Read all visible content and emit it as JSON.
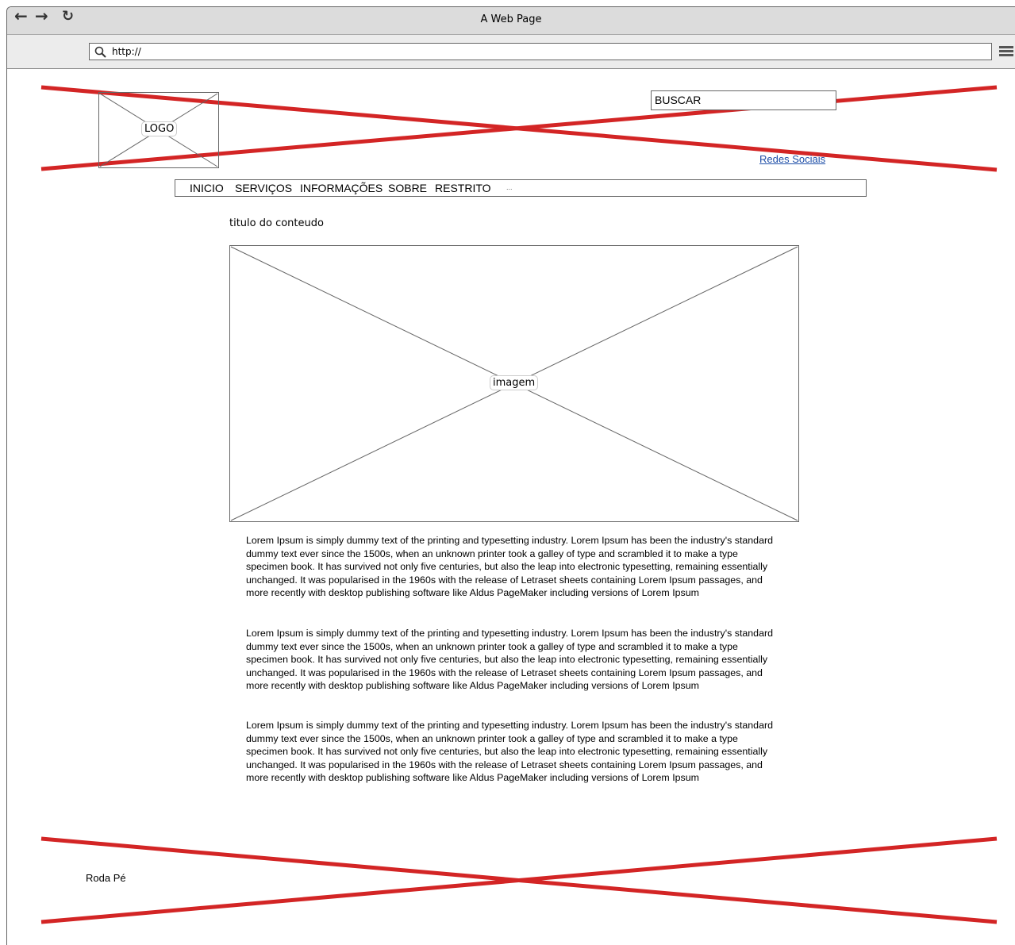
{
  "window": {
    "title": "A Web Page"
  },
  "browser": {
    "url": "http://",
    "back_icon": "arrow-left-icon",
    "forward_icon": "arrow-right-icon",
    "reload_icon": "reload-icon",
    "search_icon": "magnifier-icon",
    "menu_icon": "hamburger-icon"
  },
  "header": {
    "logo_label": "LOGO",
    "search_text": "BUSCAR",
    "social_link": "Redes Sociais"
  },
  "nav": {
    "items": [
      "INICIO",
      "SERVIÇOS",
      "INFORMAÇÕES",
      "SOBRE",
      "RESTRITO"
    ],
    "more": "..."
  },
  "content": {
    "title": "titulo do conteudo",
    "image_label": "imagem",
    "paragraphs": [
      "Lorem Ipsum is simply dummy text of the printing and typesetting industry. Lorem Ipsum has been the industry's standard dummy text ever since the 1500s, when an unknown printer took a galley of type and scrambled it to make a type specimen book. It has survived not only five centuries, but also the leap into electronic typesetting, remaining essentially unchanged. It was popularised in the 1960s with the release of Letraset sheets containing Lorem Ipsum passages, and more recently with desktop publishing software like Aldus PageMaker including versions of Lorem Ipsum",
      "Lorem Ipsum is simply dummy text of the printing and typesetting industry. Lorem Ipsum has been the industry's standard dummy text ever since the 1500s, when an unknown printer took a galley of type and scrambled it to make a type specimen book. It has survived not only five centuries, but also the leap into electronic typesetting, remaining essentially unchanged. It was popularised in the 1960s with the release of Letraset sheets containing Lorem Ipsum passages, and more recently with desktop publishing software like Aldus PageMaker including versions of Lorem Ipsum",
      "Lorem Ipsum is simply dummy text of the printing and typesetting industry. Lorem Ipsum has been the industry's standard dummy text ever since the 1500s, when an unknown printer took a galley of type and scrambled it to make a type specimen book. It has survived not only five centuries, but also the leap into electronic typesetting, remaining essentially unchanged. It was popularised in the 1960s with the release of Letraset sheets containing Lorem Ipsum passages, and more recently with desktop publishing software like Aldus PageMaker including versions of Lorem Ipsum"
    ]
  },
  "footer": {
    "label": "Roda Pé"
  },
  "colors": {
    "cross_red": "#d32525",
    "link_blue": "#1f4fa8"
  }
}
